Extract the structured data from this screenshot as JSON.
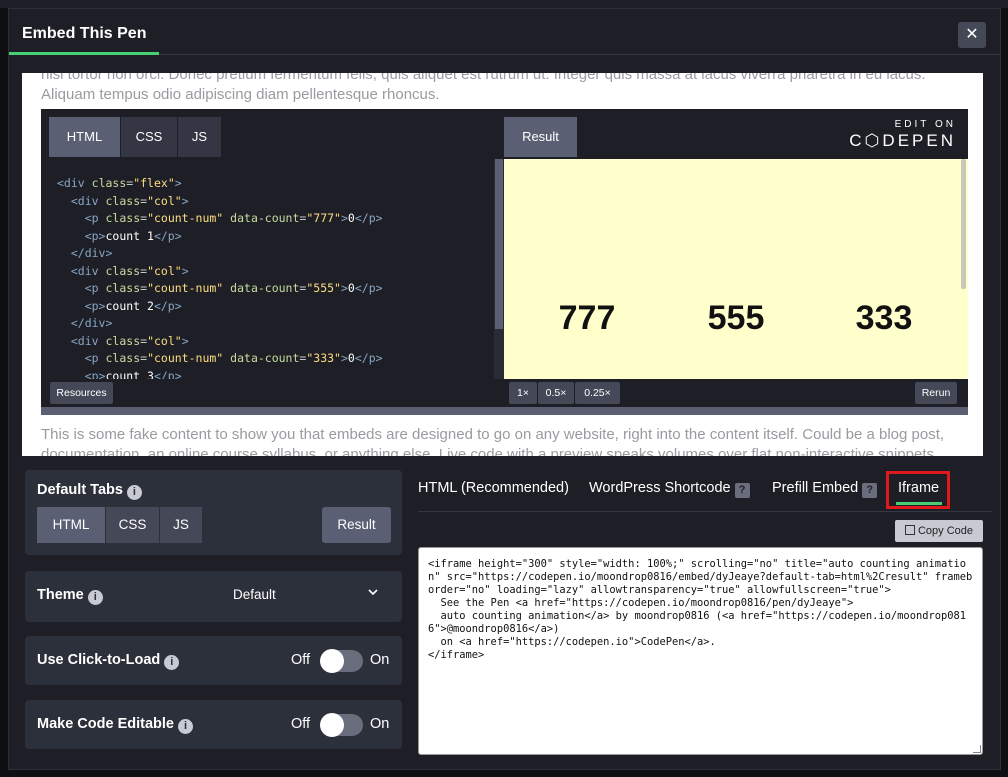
{
  "modal": {
    "title": "Embed This Pen",
    "close_label": "✕"
  },
  "preview": {
    "top_text": "nisi tortor non orci. Donec pretium fermentum felis, quis aliquet est rutrum ut. Integer quis massa at lacus viverra pharetra in eu lacus. Aliquam tempus odio adipiscing diam pellentesque rhoncus.",
    "bottom_text": "This is some fake content to show you that embeds are designed to go on any website, right into the content itself. Could be a blog post, documentation, an online course syllabus, or anything else. Live code with a preview speaks volumes over flat non-interactive snippets. Demo"
  },
  "embed": {
    "tabs": {
      "html": "HTML",
      "css": "CSS",
      "js": "JS",
      "result": "Result"
    },
    "logo_edit": "EDIT ON",
    "logo_name": "C⬡DEPEN",
    "results": [
      "777",
      "555",
      "333"
    ],
    "footer": {
      "resources": "Resources",
      "x1": "1×",
      "x05": "0.5×",
      "x025": "0.25×",
      "rerun": "Rerun"
    }
  },
  "settings": {
    "default_tabs": {
      "label": "Default Tabs",
      "html": "HTML",
      "css": "CSS",
      "js": "JS",
      "result": "Result"
    },
    "theme": {
      "label": "Theme",
      "value": "Default"
    },
    "click_to_load": {
      "label": "Use Click-to-Load",
      "off": "Off",
      "on": "On"
    },
    "editable": {
      "label": "Make Code Editable",
      "off": "Off",
      "on": "On"
    }
  },
  "code_tabs": {
    "html": "HTML (Recommended)",
    "wordpress": "WordPress Shortcode",
    "prefill": "Prefill Embed",
    "iframe": "Iframe",
    "active": "Iframe"
  },
  "copy_label": "Copy Code",
  "iframe_code": "<iframe height=\"300\" style=\"width: 100%;\" scrolling=\"no\" title=\"auto counting animation\" src=\"https://codepen.io/moondrop0816/embed/dyJeaye?default-tab=html%2Cresult\" frameborder=\"no\" loading=\"lazy\" allowtransparency=\"true\" allowfullscreen=\"true\">\n  See the Pen <a href=\"https://codepen.io/moondrop0816/pen/dyJeaye\">\n  auto counting animation</a> by moondrop0816 (<a href=\"https://codepen.io/moondrop0816\">@moondrop0816</a>)\n  on <a href=\"https://codepen.io\">CodePen</a>.\n</iframe>",
  "colors": {
    "accent": "#47cf73",
    "highlight": "#e0191c",
    "result_bg": "#ffffcc"
  }
}
